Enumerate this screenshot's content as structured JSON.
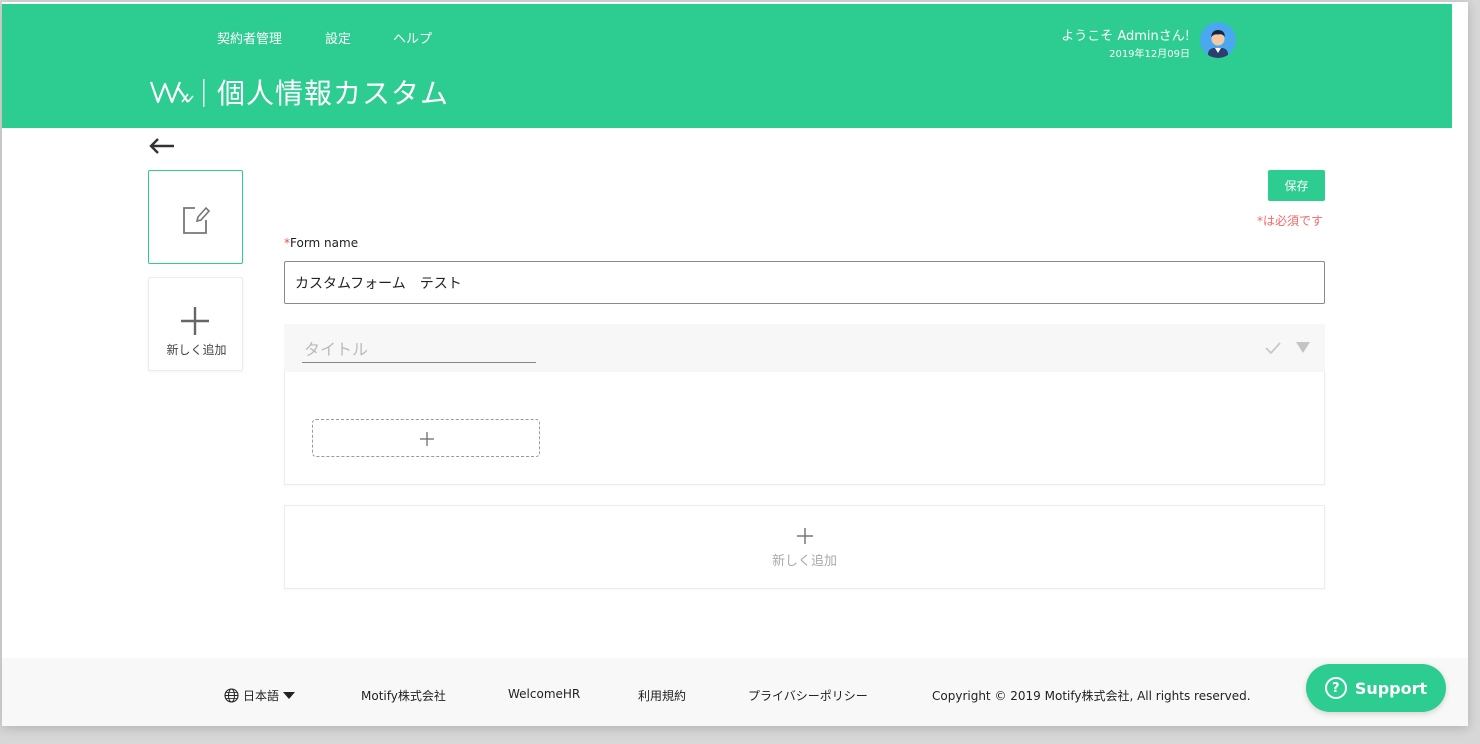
{
  "header": {
    "nav": [
      "契約者管理",
      "設定",
      "ヘルプ"
    ],
    "title_separator": "|",
    "page_title": "個人情報カスタム",
    "welcome": "ようこそ Adminさん!",
    "date": "2019年12月09日"
  },
  "sidebar": {
    "add_label": "新しく追加"
  },
  "toolbar": {
    "save_label": "保存",
    "required_note": "*は必須です"
  },
  "form": {
    "label_star": "*",
    "label": "Form name",
    "value": "カスタムフォーム　テスト"
  },
  "section": {
    "title_placeholder": "タイトル"
  },
  "new_section": {
    "label": "新しく追加"
  },
  "footer": {
    "language": "日本語",
    "links": [
      "Motify株式会社",
      "WelcomeHR",
      "利用規約",
      "プライバシーポリシー"
    ],
    "copyright": "Copyright © 2019 Motify株式会社, All rights reserved."
  },
  "support": {
    "label": "Support",
    "icon_glyph": "?"
  },
  "colors": {
    "brand": "#2dcc91",
    "required": "#f06a6a"
  }
}
